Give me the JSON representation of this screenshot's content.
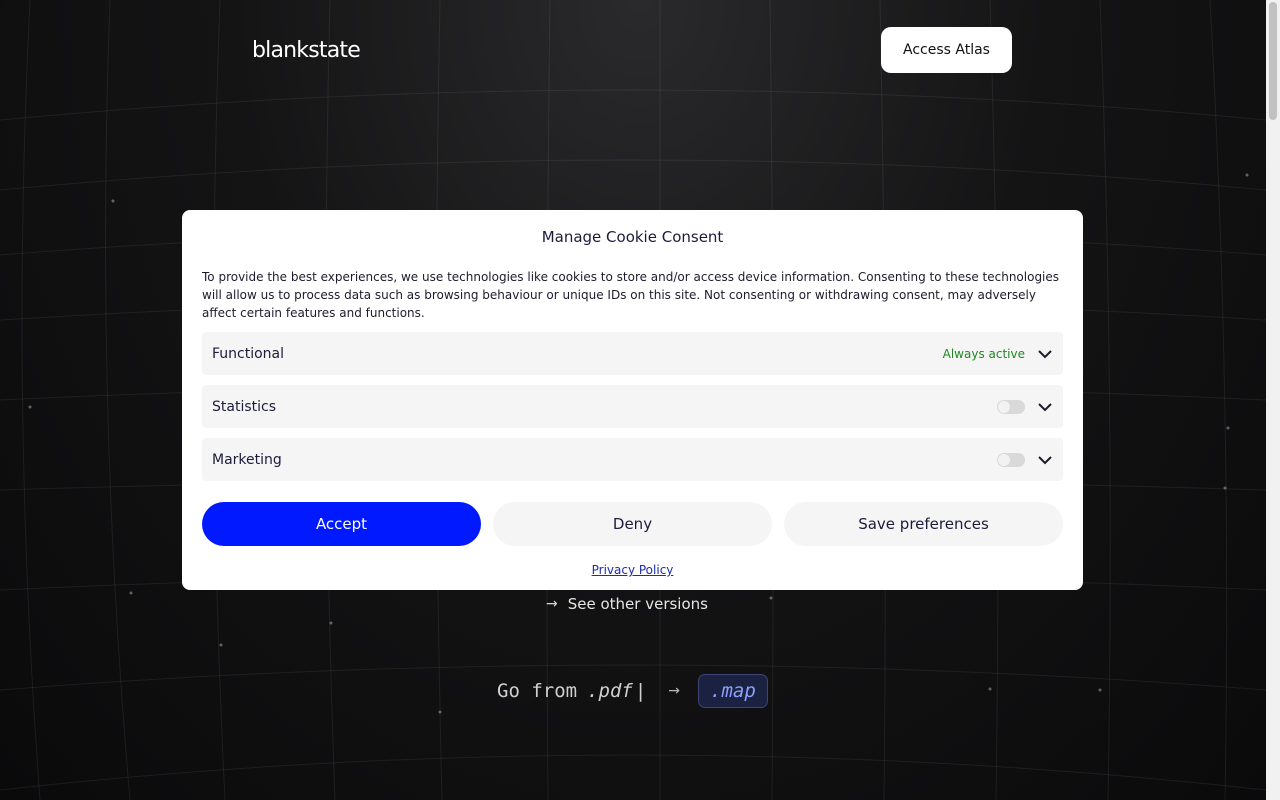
{
  "header": {
    "logo_text": "blankstate",
    "cta_label": "Access Atlas"
  },
  "hero": {
    "see_other_label": "See other versions",
    "go_from_prefix": "Go from",
    "go_from_ext": ".pdf",
    "go_from_cursor": "|",
    "go_to_ext": ".map"
  },
  "cookie_modal": {
    "title": "Manage Cookie Consent",
    "description": "To provide the best experiences, we use technologies like cookies to store and/or access device information. Consenting to these technologies will allow us to process data such as browsing behaviour or unique IDs on this site. Not consenting or withdrawing consent, may adversely affect certain features and functions.",
    "categories": [
      {
        "label": "Functional",
        "status": "Always active"
      },
      {
        "label": "Statistics",
        "enabled": false
      },
      {
        "label": "Marketing",
        "enabled": false
      }
    ],
    "buttons": {
      "accept": "Accept",
      "deny": "Deny",
      "save": "Save preferences"
    },
    "privacy_link": "Privacy Policy"
  },
  "colors": {
    "accept_button": "#0019ff",
    "always_active": "#1e8a1e",
    "background": "#0b0b0c"
  }
}
